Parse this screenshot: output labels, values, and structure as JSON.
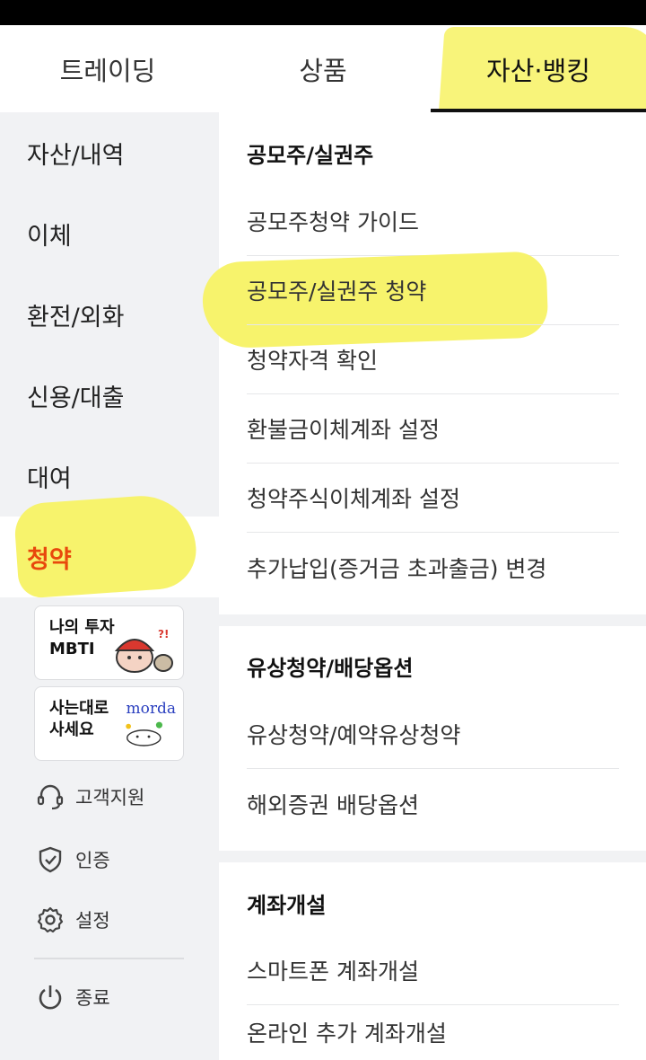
{
  "tabs": [
    {
      "label": "트레이딩"
    },
    {
      "label": "상품"
    },
    {
      "label": "자산·뱅킹"
    }
  ],
  "sidebar": {
    "items": [
      {
        "label": "자산/내역"
      },
      {
        "label": "이체"
      },
      {
        "label": "환전/외화"
      },
      {
        "label": "신용/대출"
      },
      {
        "label": "대여"
      },
      {
        "label": "청약"
      }
    ],
    "banners": [
      {
        "line1": "나의 투자",
        "line2": "MBTI"
      },
      {
        "line1": "사는대로",
        "line2": "사세요",
        "logo": "morda"
      }
    ],
    "utils": [
      {
        "label": "고객지원",
        "icon": "headset-icon"
      },
      {
        "label": "인증",
        "icon": "shield-check-icon"
      },
      {
        "label": "설정",
        "icon": "gear-icon"
      },
      {
        "label": "종료",
        "icon": "power-icon"
      }
    ]
  },
  "sections": [
    {
      "title": "공모주/실권주",
      "items": [
        "공모주청약 가이드",
        "공모주/실권주 청약",
        "청약자격 확인",
        "환불금이체계좌 설정",
        "청약주식이체계좌 설정",
        "추가납입(증거금 초과출금) 변경"
      ]
    },
    {
      "title": "유상청약/배당옵션",
      "items": [
        "유상청약/예약유상청약",
        "해외증권 배당옵션"
      ]
    },
    {
      "title": "계좌개설",
      "items": [
        "스마트폰 계좌개설",
        "온라인 추가 계좌개설"
      ]
    }
  ],
  "colors": {
    "accent_orange": "#e8480c",
    "highlight_yellow": "#f7f36c",
    "sidebar_bg": "#f1f2f4"
  }
}
